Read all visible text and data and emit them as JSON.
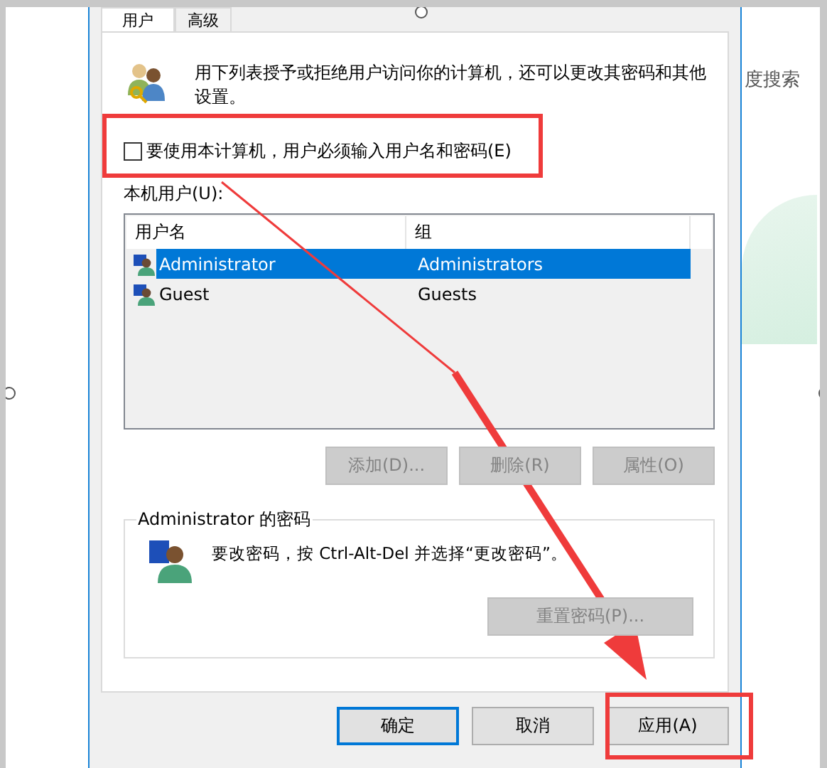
{
  "background_page": {
    "search_text": "度搜索"
  },
  "dialog": {
    "tabs": [
      {
        "label": "用户",
        "selected": true
      },
      {
        "label": "高级",
        "selected": false
      }
    ],
    "intro": "用下列表授予或拒绝用户访问你的计算机，还可以更改其密码和其他设置。",
    "require_password": {
      "label": "要使用本计算机，用户必须输入用户名和密码(E)",
      "checked": false
    },
    "users_label": "本机用户(U):",
    "table": {
      "columns": [
        "用户名",
        "组"
      ],
      "rows": [
        {
          "cells": [
            "Administrator",
            "Administrators"
          ],
          "selected": true
        },
        {
          "cells": [
            "Guest",
            "Guests"
          ],
          "selected": false
        }
      ]
    },
    "list_buttons": [
      {
        "label": "添加(D)...",
        "disabled": true
      },
      {
        "label": "删除(R)",
        "disabled": true
      },
      {
        "label": "属性(O)",
        "disabled": true
      }
    ],
    "password_group": {
      "title": "Administrator 的密码",
      "text": "要改密码，按 Ctrl-Alt-Del 并选择“更改密码”。",
      "button": {
        "label": "重置密码(P)...",
        "disabled": true
      }
    },
    "footer_buttons": [
      {
        "label": "确定",
        "default": true
      },
      {
        "label": "取消",
        "default": false
      },
      {
        "label": "应用(A)",
        "default": false
      }
    ]
  }
}
